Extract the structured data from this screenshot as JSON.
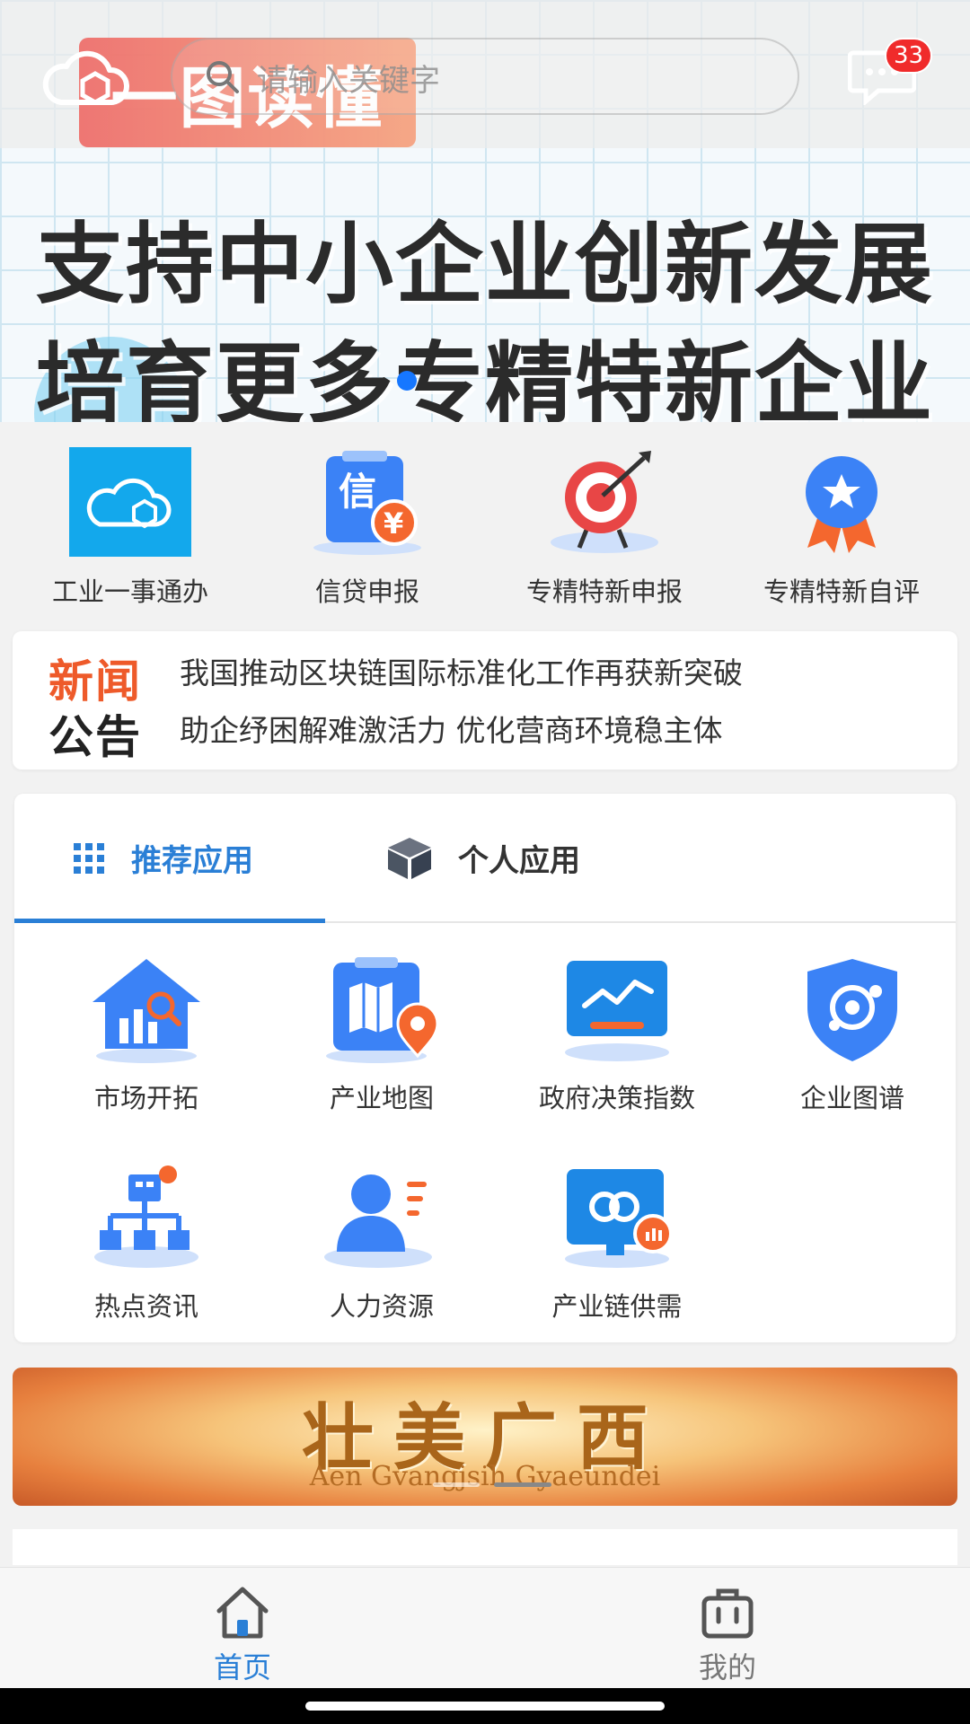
{
  "hero": {
    "tag_text": "一图读懂",
    "line1": "支持中小企业创新发展",
    "line2": "培育更多专精特新企业"
  },
  "search": {
    "placeholder": "请输入关键字"
  },
  "messages": {
    "badge_count": "33"
  },
  "quick_entries": [
    {
      "label": "工业一事通办",
      "icon": "cloud-gear-icon"
    },
    {
      "label": "信贷申报",
      "icon": "credit-yen-icon"
    },
    {
      "label": "专精特新申报",
      "icon": "target-arrow-icon"
    },
    {
      "label": "专精特新自评",
      "icon": "star-medal-icon"
    }
  ],
  "news": {
    "badge_line1": "新闻",
    "badge_line2": "公告",
    "items": [
      "我国推动区块链国际标准化工作再获新突破",
      "助企纾困解难激活力 优化营商环境稳主体"
    ]
  },
  "app_tabs": [
    {
      "label": "推荐应用",
      "icon": "grid-dots-icon",
      "active": true
    },
    {
      "label": "个人应用",
      "icon": "cube-icon",
      "active": false
    }
  ],
  "apps": [
    {
      "label": "市场开拓",
      "icon": "market-house-icon"
    },
    {
      "label": "产业地图",
      "icon": "map-pin-icon"
    },
    {
      "label": "政府决策指数",
      "icon": "monitor-chart-icon"
    },
    {
      "label": "企业图谱",
      "icon": "shield-network-icon"
    },
    {
      "label": "热点资讯",
      "icon": "org-chart-icon"
    },
    {
      "label": "人力资源",
      "icon": "person-list-icon"
    },
    {
      "label": "产业链供需",
      "icon": "monitor-link-icon"
    }
  ],
  "guangxi_banner": {
    "title": "壮美广西",
    "subtitle": "Aen Gvangjsih Gyaeundei"
  },
  "bottom_nav": [
    {
      "label": "首页",
      "icon": "home-icon",
      "active": true
    },
    {
      "label": "我的",
      "icon": "briefcase-icon",
      "active": false
    }
  ],
  "colors": {
    "accent": "#2a7fd6",
    "badge_red": "#f02b2b",
    "news_orange": "#ee5a2a"
  }
}
